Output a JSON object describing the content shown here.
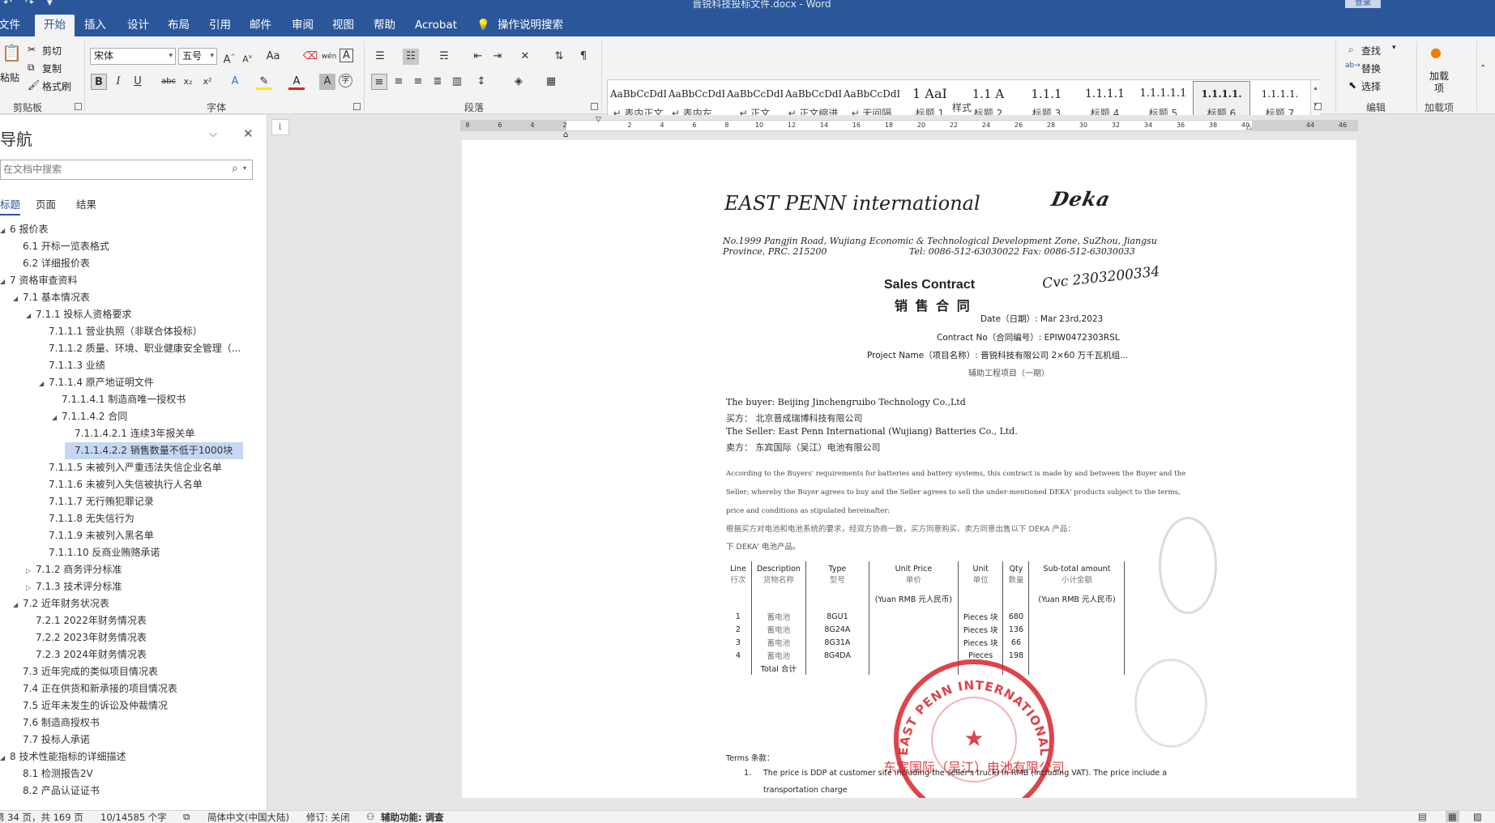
{
  "window": {
    "title": "晋锐科技投标文件.docx  -  Word",
    "qat": "↶ ↷ ▾",
    "account_btn": "登录"
  },
  "tabs": [
    {
      "label": "文件",
      "active": false
    },
    {
      "label": "开始",
      "active": true
    },
    {
      "label": "插入",
      "active": false
    },
    {
      "label": "设计",
      "active": false
    },
    {
      "label": "布局",
      "active": false
    },
    {
      "label": "引用",
      "active": false
    },
    {
      "label": "邮件",
      "active": false
    },
    {
      "label": "审阅",
      "active": false
    },
    {
      "label": "视图",
      "active": false
    },
    {
      "label": "帮助",
      "active": false
    },
    {
      "label": "Acrobat",
      "active": false
    }
  ],
  "tell_me": "操作说明搜索",
  "ribbon": {
    "clipboard": {
      "paste": "粘贴",
      "cut": "剪切",
      "copy": "复制",
      "format_painter": "格式刷",
      "label": "剪贴板"
    },
    "font": {
      "name": "宋体",
      "size": "五号",
      "label": "字体"
    },
    "paragraph": {
      "label": "段落"
    },
    "styles": {
      "label": "样式",
      "items": [
        {
          "sample": "AaBbCcDdI",
          "name": "↵ 表内正文"
        },
        {
          "sample": "AaBbCcDdEe",
          "name": "↵ 表内左..."
        },
        {
          "sample": "AaBbCcDdI",
          "name": "↵ 正文"
        },
        {
          "sample": "AaBbCcDdI",
          "name": "↵ 正文缩进"
        },
        {
          "sample": "AaBbCcDdI",
          "name": "↵ 无间隔"
        },
        {
          "sample": "1  AaI",
          "name": "标题 1"
        },
        {
          "sample": "1.1  A",
          "name": "标题 2"
        },
        {
          "sample": "1.1.1",
          "name": "标题 3"
        },
        {
          "sample": "1.1.1.1",
          "name": "标题 4"
        },
        {
          "sample": "1.1.1.1.1",
          "name": "标题 5"
        },
        {
          "sample": "1.1.1.1.",
          "name": "标题 6"
        },
        {
          "sample": "1.1.1.1.",
          "name": "标题 7"
        }
      ]
    },
    "editing": {
      "find": "查找",
      "replace": "替换",
      "select": "选择",
      "label": "编辑"
    },
    "addins": {
      "button": "加载项",
      "label": "加载项"
    }
  },
  "nav": {
    "title": "导航",
    "search_placeholder": "在文档中搜索",
    "tabs": [
      "标题",
      "页面",
      "结果"
    ],
    "items": [
      {
        "text": "6 报价表",
        "level": 0,
        "tw": "◢",
        "sel": false
      },
      {
        "text": "6.1 开标一览表格式",
        "level": 1,
        "tw": "",
        "sel": false
      },
      {
        "text": "6.2 详细报价表",
        "level": 1,
        "tw": "",
        "sel": false
      },
      {
        "text": "7 资格审查资料",
        "level": 0,
        "tw": "◢",
        "sel": false
      },
      {
        "text": "7.1 基本情况表",
        "level": 1,
        "tw": "◢",
        "sel": false
      },
      {
        "text": "7.1.1 投标人资格要求",
        "level": 2,
        "tw": "◢",
        "sel": false
      },
      {
        "text": "7.1.1.1 营业执照（非联合体投标）",
        "level": 3,
        "tw": "",
        "sel": false
      },
      {
        "text": "7.1.1.2 质量、环境、职业健康安全管理（...",
        "level": 3,
        "tw": "",
        "sel": false
      },
      {
        "text": "7.1.1.3 业绩",
        "level": 3,
        "tw": "",
        "sel": false
      },
      {
        "text": "7.1.1.4 原产地证明文件",
        "level": 3,
        "tw": "◢",
        "sel": false
      },
      {
        "text": "7.1.1.4.1 制造商唯一授权书",
        "level": 4,
        "tw": "",
        "sel": false
      },
      {
        "text": "7.1.1.4.2 合同",
        "level": 4,
        "tw": "◢",
        "sel": false
      },
      {
        "text": "7.1.1.4.2.1 连续3年报关单",
        "level": 5,
        "tw": "",
        "sel": false
      },
      {
        "text": "7.1.1.4.2.2 销售数量不低于1000块",
        "level": 5,
        "tw": "",
        "sel": true
      },
      {
        "text": "7.1.1.5 未被列入严重违法失信企业名单",
        "level": 3,
        "tw": "",
        "sel": false
      },
      {
        "text": "7.1.1.6 未被列入失信被执行人名单",
        "level": 3,
        "tw": "",
        "sel": false
      },
      {
        "text": "7.1.1.7 无行贿犯罪记录",
        "level": 3,
        "tw": "",
        "sel": false
      },
      {
        "text": "7.1.1.8 无失信行为",
        "level": 3,
        "tw": "",
        "sel": false
      },
      {
        "text": "7.1.1.9 未被列入黑名单",
        "level": 3,
        "tw": "",
        "sel": false
      },
      {
        "text": "7.1.1.10 反商业贿赂承诺",
        "level": 3,
        "tw": "",
        "sel": false
      },
      {
        "text": "7.1.2 商务评分标准",
        "level": 2,
        "tw": "▷",
        "sel": false
      },
      {
        "text": "7.1.3 技术评分标准",
        "level": 2,
        "tw": "▷",
        "sel": false
      },
      {
        "text": "7.2 近年财务状况表",
        "level": 1,
        "tw": "◢",
        "sel": false
      },
      {
        "text": "7.2.1 2022年财务情况表",
        "level": 2,
        "tw": "",
        "sel": false
      },
      {
        "text": "7.2.2 2023年财务情况表",
        "level": 2,
        "tw": "",
        "sel": false
      },
      {
        "text": "7.2.3 2024年财务情况表",
        "level": 2,
        "tw": "",
        "sel": false
      },
      {
        "text": "7.3 近年完成的类似项目情况表",
        "level": 1,
        "tw": "",
        "sel": false
      },
      {
        "text": "7.4 正在供货和新承接的项目情况表",
        "level": 1,
        "tw": "",
        "sel": false
      },
      {
        "text": "7.5 近年未发生的诉讼及仲裁情况",
        "level": 1,
        "tw": "",
        "sel": false
      },
      {
        "text": "7.6 制造商授权书",
        "level": 1,
        "tw": "",
        "sel": false
      },
      {
        "text": "7.7 投标人承诺",
        "level": 1,
        "tw": "",
        "sel": false
      },
      {
        "text": "8 技术性能指标的详细描述",
        "level": 0,
        "tw": "◢",
        "sel": false
      },
      {
        "text": "8.1 检测报告2V",
        "level": 1,
        "tw": "",
        "sel": false
      },
      {
        "text": "8.2 产品认证证书",
        "level": 1,
        "tw": "",
        "sel": false
      }
    ]
  },
  "ruler": {
    "ticks": [
      "8",
      "6",
      "4",
      "2",
      "",
      "2",
      "4",
      "6",
      "8",
      "10",
      "12",
      "14",
      "16",
      "18",
      "20",
      "22",
      "24",
      "26",
      "28",
      "30",
      "32",
      "34",
      "36",
      "38",
      "40",
      "",
      "44",
      "46",
      "48"
    ]
  },
  "doc": {
    "company": "EAST PENN international",
    "logo": "Deka",
    "address1": "No.1999 Pangjin Road, Wujiang Economic & Technological Development Zone, SuZhou, Jiangsu",
    "address2": "Province, PRC. 215200",
    "tel_fax": "Tel: 0086-512-63030022     Fax: 0086-512-63030033",
    "title_en": "Sales Contract",
    "title_cn": "销 售 合 同",
    "handwritten": "Cvc 2303200334",
    "date": "Date（日期）: Mar 23rd,2023",
    "contract_no": "Contract No（合同编号）: EPIW0472303RSL",
    "project_name": "Project Name（项目名称）: 晋锐科技有限公司 2×60 万千瓦机组...",
    "project_name2": "辅助工程项目（一期）",
    "buyer_en": "The buyer: Beijing Jinchengruibo Technology Co.,Ltd",
    "buyer_cn": "买方：      北京晋成瑞博科技有限公司",
    "seller_en": "The Seller: East Penn International (Wujiang) Batteries Co., Ltd.",
    "seller_cn": "卖方：      东宾国际（吴江）电池有限公司",
    "p1": "According to the Buyers' requirements for batteries and battery systems, this contract is made by and between the Buyer and the",
    "p2": "Seller; whereby the Buyer agrees to buy and the Seller agrees to sell the under-mentioned DEKA' products subject to the terms,",
    "p3": "price and conditions as stipulated hereinafter:",
    "p4": "根据买方对电池和电池系统的要求，经双方协商一致，买方同意购买、卖方同意出售以下 DEKA 产品：",
    "p5": "下 DEKA' 电池产品。",
    "table": {
      "headers": [
        [
          "Line",
          "行次"
        ],
        [
          "Description",
          "货物名称"
        ],
        [
          "Type",
          "型号"
        ],
        [
          "Unit Price",
          "单价"
        ],
        [
          "Unit",
          "单位"
        ],
        [
          "Qty",
          "数量"
        ],
        [
          "Sub-total amount",
          "小计金额"
        ]
      ],
      "currency": "(Yuan RMB 元人民币)",
      "rows": [
        [
          "1",
          "蓄电池",
          "8GU1",
          "",
          "Pieces 块",
          "680",
          ""
        ],
        [
          "2",
          "蓄电池",
          "8G24A",
          "",
          "Pieces 块",
          "136",
          ""
        ],
        [
          "3",
          "蓄电池",
          "8G31A",
          "",
          "Pieces 块",
          "66",
          ""
        ],
        [
          "4",
          "蓄电池",
          "8G4DA",
          "",
          "Pieces",
          "198",
          ""
        ]
      ],
      "total": "Total 合计"
    },
    "stamp_text": "EAST PENN INTERNATIONAL (WUJIANG) BATTERIES CO.,LTD",
    "stamp_cn": "东宾国际（吴江）电池有限公司",
    "terms": "Terms   条款：",
    "term1_num": "1.",
    "term1": "The price is DDP at customer site including the seller's truck) in RMB (including VAT). The price include a",
    "term1b": "transportation charge"
  },
  "status": {
    "page": "第 34 页，共 169 页",
    "words": "10/14585 个字",
    "lang": "简体中文(中国大陆)",
    "track": "修订: 关闭",
    "access": "辅助功能: 调查"
  },
  "colors": {
    "brand": "#2b579a",
    "stamp": "#d8232a"
  }
}
